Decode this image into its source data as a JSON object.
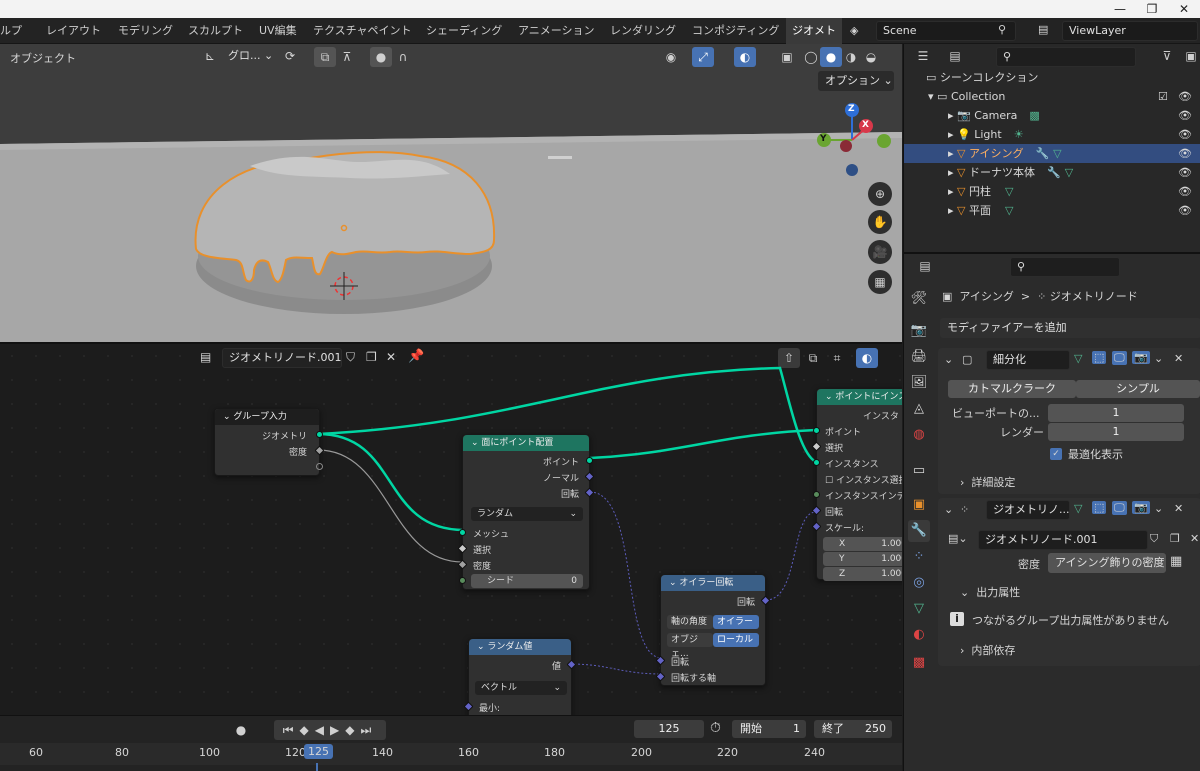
{
  "window": {
    "minimize": "—",
    "maximize": "❐",
    "close": "✕"
  },
  "menu_tabs": [
    "ルプ",
    "レイアウト",
    "モデリング",
    "スカルプト",
    "UV編集",
    "テクスチャペイント",
    "シェーディング",
    "アニメーション",
    "レンダリング",
    "コンポジティング",
    "ジオメト"
  ],
  "scene": {
    "label": "Scene",
    "viewlayer": "ViewLayer"
  },
  "viewport": {
    "mode_label": "オブジェクト",
    "transform_orient": "グロ...",
    "options_label": "オプション",
    "gizmo": {
      "z": "Z",
      "y": "Y",
      "x": "X"
    }
  },
  "node_editor": {
    "tree_name": "ジオメトリノード.001",
    "nodes": {
      "group_input": {
        "title": "グループ入力",
        "out_geometry": "ジオメトリ",
        "out_density": "密度"
      },
      "distribute": {
        "title": "面にポイント配置",
        "out_points": "ポイント",
        "out_normal": "ノーマル",
        "out_rotation": "回転",
        "mode": "ランダム",
        "in_mesh": "メッシュ",
        "in_selection": "選択",
        "in_density": "密度",
        "seed_label": "シード",
        "seed_value": "0"
      },
      "instance": {
        "title": "ポイントにインス",
        "out_instances": "インスタ",
        "in_points": "ポイント",
        "in_selection": "選択",
        "in_instance": "インスタンス",
        "in_pick": "インスタンス選択",
        "in_index": "インスタンスインデ",
        "in_rotation": "回転",
        "in_scale": "スケール:",
        "sx_label": "X",
        "sx": "1.000",
        "sy_label": "Y",
        "sy": "1.000",
        "sz_label": "Z",
        "sz": "1.000"
      },
      "euler": {
        "title": "オイラー回転",
        "out_rotation": "回転",
        "axis_label": "軸の角度",
        "axis_value": "オイラー",
        "space_label": "オブジェ...",
        "space_value": "ローカル",
        "in_rotation": "回転",
        "in_rotate_by": "回転する軸"
      },
      "random": {
        "title": "ランダム値",
        "out_value": "値",
        "type": "ベクトル",
        "in_min": "最小:"
      }
    }
  },
  "timeline": {
    "current_frame": "125",
    "start_label": "開始",
    "start": "1",
    "end_label": "終了",
    "end": "250",
    "ruler": [
      "60",
      "80",
      "100",
      "120",
      "125",
      "140",
      "160",
      "180",
      "200",
      "220",
      "240"
    ]
  },
  "outliner": {
    "scene_collection": "シーンコレクション",
    "items": [
      {
        "name": "Collection",
        "type": "collection"
      },
      {
        "name": "Camera",
        "type": "camera"
      },
      {
        "name": "Light",
        "type": "light"
      },
      {
        "name": "アイシング",
        "type": "mesh",
        "selected": true
      },
      {
        "name": "ドーナツ本体",
        "type": "mesh"
      },
      {
        "name": "円柱",
        "type": "mesh"
      },
      {
        "name": "平面",
        "type": "mesh"
      }
    ]
  },
  "properties": {
    "breadcrumb_object": "アイシング",
    "breadcrumb_modifier": "ジオメトリノード",
    "add_modifier": "モディファイアーを追加",
    "subdiv": {
      "name": "細分化",
      "tab_catmull": "カトマルクラーク",
      "tab_simple": "シンプル",
      "viewport_label": "ビューポートの...",
      "viewport_value": "1",
      "render_label": "レンダー",
      "render_value": "1",
      "optimal_label": "最適化表示",
      "advanced_label": "詳細設定"
    },
    "geonodes": {
      "name": "ジオメトリノ...",
      "tree": "ジオメトリノード.001",
      "density_label": "密度",
      "density_value": "アイシング飾りの密度",
      "output_attrs_label": "出力属性",
      "info_text": "つながるグループ出力属性がありません",
      "internal_label": "内部依存"
    }
  },
  "colors": {
    "accent": "#4772b3",
    "geometry_socket": "#00d6a3",
    "selected_outline": "#e8902c"
  }
}
